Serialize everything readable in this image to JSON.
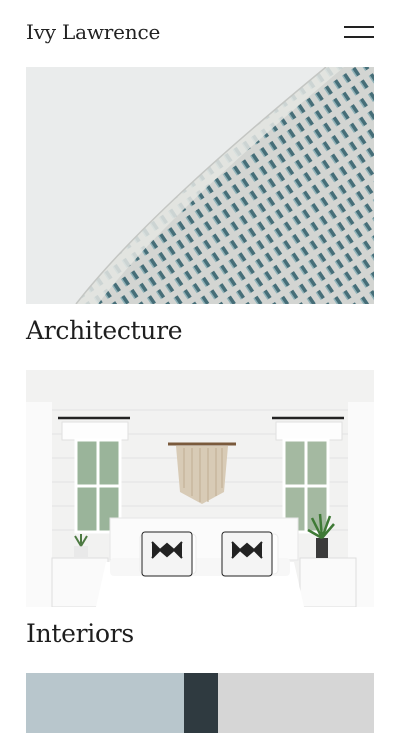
{
  "header": {
    "brand": "Ivy Lawrence",
    "menu_icon": "hamburger-menu-icon"
  },
  "projects": [
    {
      "title": "Architecture",
      "image": "curved-building-facade-photo"
    },
    {
      "title": "Interiors",
      "image": "white-bedroom-interior-photo"
    },
    {
      "title": "",
      "image": "blue-interior-photo-partial"
    }
  ],
  "colors": {
    "text": "#1e1e1e",
    "background": "#ffffff",
    "sky": "#eaecec",
    "facade": "#d8dad7",
    "window_tint": "#5f8a94"
  }
}
